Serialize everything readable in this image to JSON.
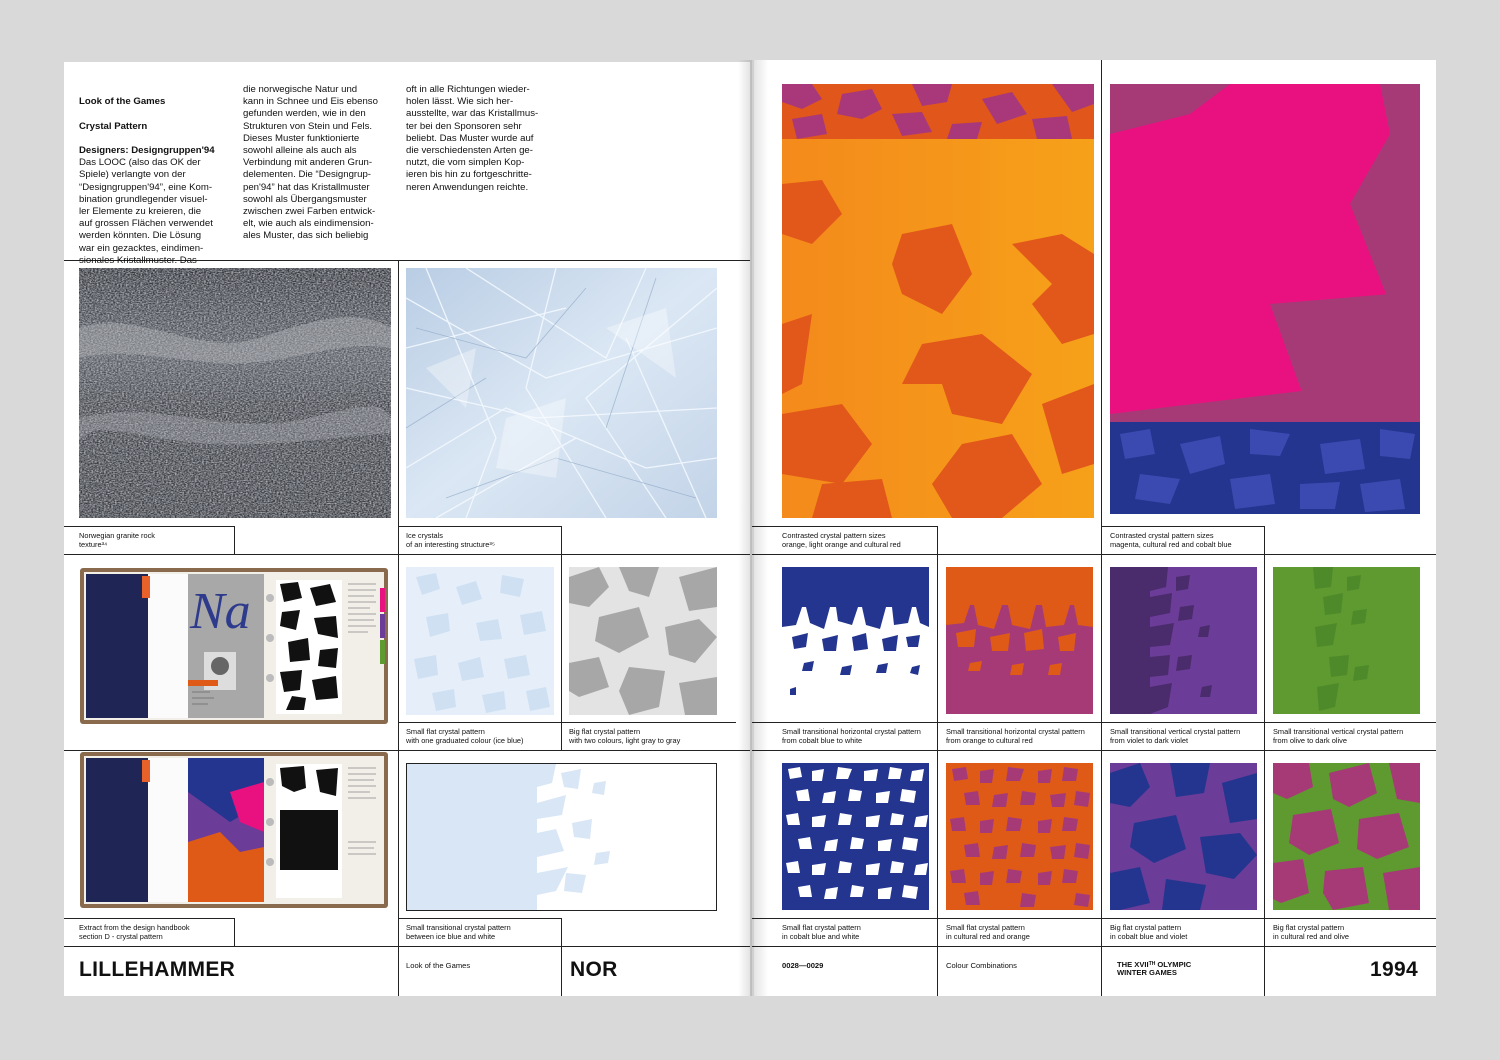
{
  "intro": {
    "heading_lines": [
      "Look of the Games",
      "Crystal Pattern",
      "Designers: Designgruppen'94"
    ],
    "col1": "Das LOOC (also das OK der\nSpiele) verlangte von der\n“Designgruppen'94”, eine Kom-\nbination grundlegender visuel-\nler Elemente zu kreieren, die\nauf grossen Flächen verwendet\nwerden könnten. Die Lösung\nwar ein gezacktes, eindimen-\nsionales Kristallmuster. Das\nKristallmuster ist typisch für",
    "col2": "die norwegische Natur und\nkann in Schnee und Eis ebenso\ngefunden werden, wie in den\nStrukturen von Stein und Fels.\nDieses Muster funktionierte\nsowohl alleine als auch als\nVerbindung mit anderen Grun-\ndelementen. Die “Designgrup-\npen'94” hat das Kristallmuster\nsowohl als Übergangsmuster\nzwischen zwei Farben entwick-\nelt, wie auch als eindimension-\nales Muster, das sich beliebig",
    "col3": "oft in alle Richtungen wieder-\nholen lässt. Wie sich her-\nausstellte, war das Kristallmus-\nter bei den Sponsoren sehr\nbeliebt. Das Muster wurde auf\ndie verschiedensten Arten ge-\nnutzt, die vom simplen Kop-\nieren bis hin zu fortgeschritte-\nneren Anwendungen reichte."
  },
  "captions": {
    "granite": [
      "Norwegian granite rock",
      "texture³⁴"
    ],
    "ice": [
      "Ice crystals",
      "of an interesting structure³⁵"
    ],
    "orange_big": [
      "Contrasted crystal pattern sizes",
      "orange, light orange and cultural red"
    ],
    "magenta_big": [
      "Contrasted crystal pattern sizes",
      "magenta, cultural red and cobalt blue"
    ],
    "handbook": [
      "Extract from the design handbook",
      "section D - crystal pattern"
    ],
    "small_ice": [
      "Small flat crystal pattern",
      "with one graduated colour (ice blue)"
    ],
    "big_gray": [
      "Big flat crystal pattern",
      "with two colours, light gray to gray"
    ],
    "trans_ice": [
      "Small transitional crystal pattern",
      "between ice blue and white"
    ],
    "r1": [
      [
        "Small transitional horizontal crystal pattern",
        "from cobalt blue to white"
      ],
      [
        "Small transitional horizontal crystal pattern",
        "from orange to cultural red"
      ],
      [
        "Small transitional vertical crystal pattern",
        "from violet to dark violet"
      ],
      [
        "Small transitional vertical crystal pattern",
        "from olive to dark olive"
      ]
    ],
    "r2": [
      [
        "Small flat crystal pattern",
        "in cobalt blue and white"
      ],
      [
        "Small flat crystal pattern",
        "in cultural red and orange"
      ],
      [
        "Big flat crystal pattern",
        "in cobalt blue and violet"
      ],
      [
        "Big flat crystal pattern",
        "in cultural red and olive"
      ]
    ]
  },
  "handbook_art": {
    "letters": "Na"
  },
  "footer": {
    "city": "LILLEHAMMER",
    "section": "Look of the Games",
    "country": "NOR",
    "pages": "0028—0029",
    "topic": "Colour Combinations",
    "games_line1": "THE XVIIᵀᴴ OLYMPIC",
    "games_line2": "WINTER GAMES",
    "year": "1994"
  },
  "colors": {
    "orange": "#f39a1c",
    "cultural_red": "#e05a17",
    "magenta": "#e8117f",
    "berry": "#a63a77",
    "cobalt": "#23358f",
    "violet": "#6b3c98",
    "dark_violet": "#4a2b6c",
    "olive": "#5e9a2f",
    "ice": "#d8e6f6",
    "gray": "#a7a7a7",
    "light_gray": "#e3e3e3"
  }
}
